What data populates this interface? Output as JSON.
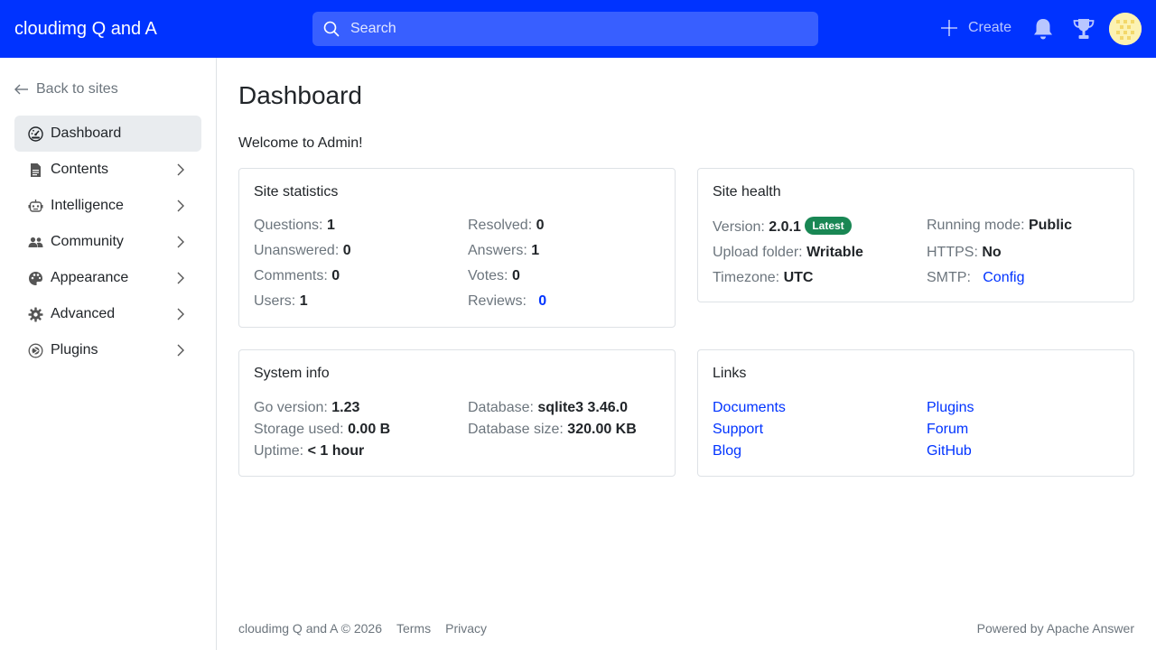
{
  "header": {
    "brand": "cloudimg Q and A",
    "search_placeholder": "Search",
    "create_label": "Create"
  },
  "sidebar": {
    "back_label": "Back to sites",
    "items": [
      {
        "label": "Dashboard",
        "icon": "dashboard-icon",
        "active": true
      },
      {
        "label": "Contents",
        "icon": "document-icon"
      },
      {
        "label": "Intelligence",
        "icon": "robot-icon"
      },
      {
        "label": "Community",
        "icon": "people-icon"
      },
      {
        "label": "Appearance",
        "icon": "palette-icon"
      },
      {
        "label": "Advanced",
        "icon": "gear-icon"
      },
      {
        "label": "Plugins",
        "icon": "plugin-icon"
      }
    ]
  },
  "main": {
    "title": "Dashboard",
    "welcome": "Welcome to Admin!",
    "site_statistics": {
      "title": "Site statistics",
      "questions_label": "Questions:",
      "questions": "1",
      "resolved_label": "Resolved:",
      "resolved": "0",
      "unanswered_label": "Unanswered:",
      "unanswered": "0",
      "answers_label": "Answers:",
      "answers": "1",
      "comments_label": "Comments:",
      "comments": "0",
      "votes_label": "Votes:",
      "votes": "0",
      "users_label": "Users:",
      "users": "1",
      "reviews_label": "Reviews:",
      "reviews": "0"
    },
    "site_health": {
      "title": "Site health",
      "version_label": "Version:",
      "version": "2.0.1",
      "version_badge": "Latest",
      "running_mode_label": "Running mode:",
      "running_mode": "Public",
      "upload_folder_label": "Upload folder:",
      "upload_folder": "Writable",
      "https_label": "HTTPS:",
      "https": "No",
      "timezone_label": "Timezone:",
      "timezone": "UTC",
      "smtp_label": "SMTP:",
      "smtp": "Config"
    },
    "system_info": {
      "title": "System info",
      "go_version_label": "Go version:",
      "go_version": "1.23",
      "database_label": "Database:",
      "database": "sqlite3 3.46.0",
      "storage_label": "Storage used:",
      "storage": "0.00 B",
      "database_size_label": "Database size:",
      "database_size": "320.00 KB",
      "uptime_label": "Uptime:",
      "uptime": "< 1 hour"
    },
    "links": {
      "title": "Links",
      "items": [
        "Documents",
        "Plugins",
        "Support",
        "Forum",
        "Blog",
        "GitHub"
      ]
    }
  },
  "footer": {
    "copyright": "cloudimg Q and A © 2026",
    "terms": "Terms",
    "privacy": "Privacy",
    "powered_by": "Powered by Apache Answer"
  },
  "colors": {
    "primary": "#0033ff",
    "success": "#198754",
    "muted": "#6c757d"
  }
}
